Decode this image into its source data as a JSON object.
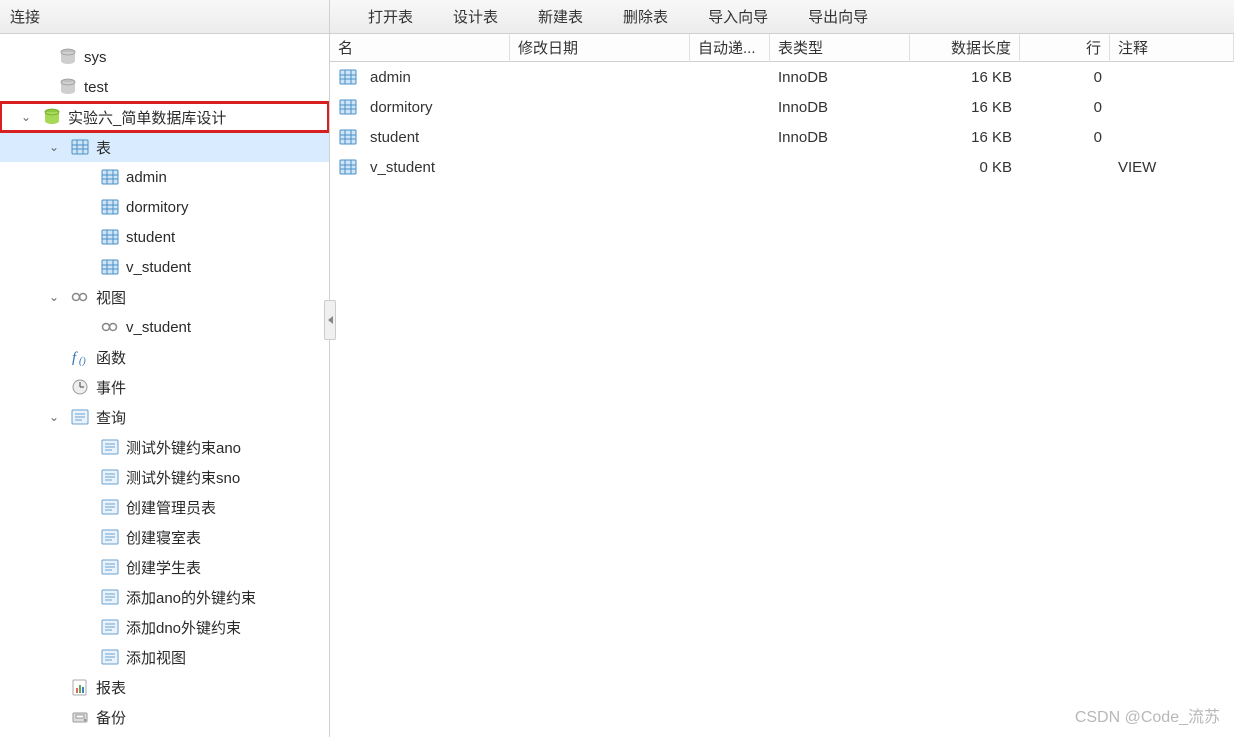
{
  "sidebar": {
    "title": "连接",
    "nodes": {
      "sys": "sys",
      "test": "test",
      "db": "实验六_简单数据库设计",
      "tables_label": "表",
      "tables": [
        "admin",
        "dormitory",
        "student",
        "v_student"
      ],
      "views_label": "视图",
      "views": [
        "v_student"
      ],
      "functions_label": "函数",
      "events_label": "事件",
      "queries_label": "查询",
      "queries": [
        "测试外键约束ano",
        "测试外键约束sno",
        "创建管理员表",
        "创建寝室表",
        "创建学生表",
        "添加ano的外键约束",
        "添加dno外键约束",
        "添加视图"
      ],
      "reports_label": "报表",
      "backup_label": "备份"
    }
  },
  "toolbar": {
    "open": "打开表",
    "design": "设计表",
    "new": "新建表",
    "delete": "删除表",
    "import": "导入向导",
    "export": "导出向导"
  },
  "table": {
    "headers": {
      "name": "名",
      "date": "修改日期",
      "auto": "自动递...",
      "type": "表类型",
      "length": "数据长度",
      "rows": "行",
      "note": "注释"
    },
    "rows": [
      {
        "name": "admin",
        "date": "",
        "auto": "",
        "type": "InnoDB",
        "length": "16 KB",
        "rows": "0",
        "note": ""
      },
      {
        "name": "dormitory",
        "date": "",
        "auto": "",
        "type": "InnoDB",
        "length": "16 KB",
        "rows": "0",
        "note": ""
      },
      {
        "name": "student",
        "date": "",
        "auto": "",
        "type": "InnoDB",
        "length": "16 KB",
        "rows": "0",
        "note": ""
      },
      {
        "name": "v_student",
        "date": "",
        "auto": "",
        "type": "",
        "length": "0 KB",
        "rows": "",
        "note": "VIEW"
      }
    ]
  },
  "watermark": "CSDN @Code_流苏"
}
